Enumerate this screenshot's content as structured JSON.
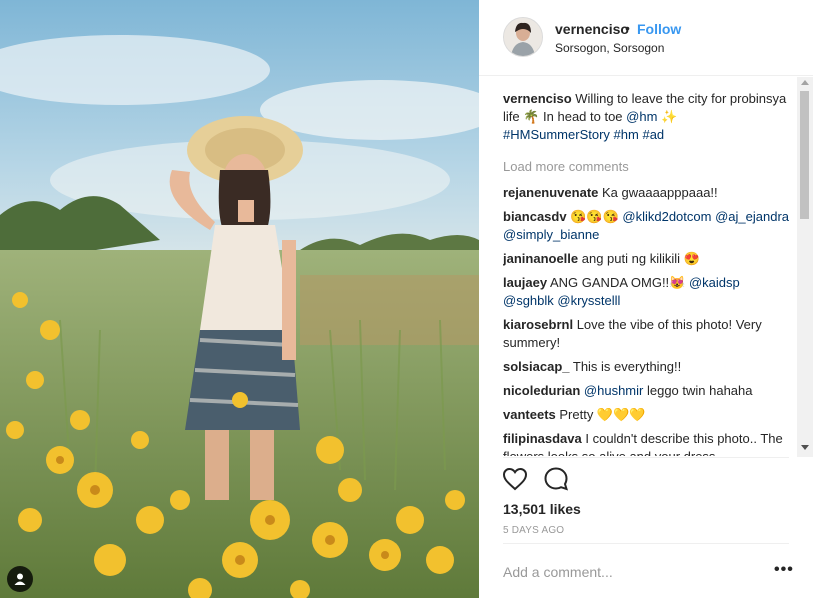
{
  "post": {
    "username": "vernenciso",
    "separator": "•",
    "follow_label": "Follow",
    "location": "Sorsogon, Sorsogon"
  },
  "caption": {
    "user": "vernenciso",
    "text": " Willing to leave the city for probinsya life 🌴 In head to toe ",
    "mention": "@hm",
    "sparkle": " ✨",
    "hashtags": [
      "#HMSummerStory",
      "#hm",
      "#ad"
    ]
  },
  "load_more": "Load more comments",
  "comments": [
    {
      "user": "rejanenuvenate",
      "text": " Ka gwaaaapppaaa!!"
    },
    {
      "user": "biancasdv",
      "text": " 😘😘😘 ",
      "mentions": [
        "@klikd2dotcom",
        "@aj_ejandra",
        "@simply_bianne"
      ]
    },
    {
      "user": "janinanoelle",
      "text": " ang puti ng kilikili 😍"
    },
    {
      "user": "laujaey",
      "text": " ANG GANDA OMG!!😻 ",
      "mentions": [
        "@kaidsp",
        "@sghblk",
        "@krysstelll"
      ]
    },
    {
      "user": "kiarosebrnl",
      "text": " Love the vibe of this photo! Very summery!"
    },
    {
      "user": "solsiacap_",
      "text": " This is everything!!"
    },
    {
      "user": "nicoledurian",
      "mention": "@hushmir",
      "text": " leggo twin hahaha"
    },
    {
      "user": "vanteets",
      "text": " Pretty 💛💛💛"
    },
    {
      "user": "filipinasdava",
      "text": " I couldn't describe this photo.. The flowers looks so alive and your dress"
    }
  ],
  "likes": "13,501 likes",
  "time_ago": "5 DAYS AGO",
  "add_comment_placeholder": "Add a comment...",
  "more_label": "•••",
  "colors": {
    "link": "#003569",
    "follow": "#3897f0",
    "muted": "#999999"
  },
  "icons": [
    "heart-icon",
    "comment-icon",
    "more-options-icon",
    "user-tag-icon"
  ]
}
